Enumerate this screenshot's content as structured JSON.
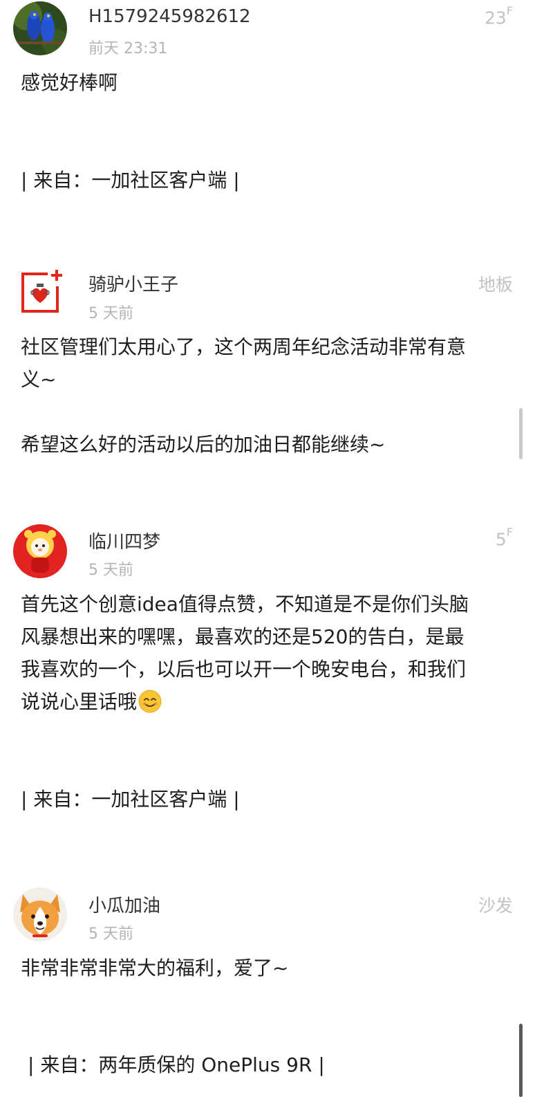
{
  "comments": [
    {
      "username": "H1579245982612",
      "time": "前天 23:31",
      "floor": "23",
      "floor_sup": "F",
      "lines": [
        "感觉好棒啊"
      ],
      "source": "| 来自：一加社区客户端 |",
      "avatar_icon": "blue-parrots-avatar"
    },
    {
      "username": "骑驴小王子",
      "time": "5 天前",
      "floor": "地板",
      "lines": [
        "社区管理们太用心了，这个两周年纪念活动非常有意",
        "义~",
        "希望这么好的活动以后的加油日都能继续~"
      ],
      "avatar_icon": "oneplus-heart-avatar"
    },
    {
      "username": "临川四梦",
      "time": "5 天前",
      "floor": "5",
      "floor_sup": "F",
      "lines": [
        "首先这个创意idea值得点赞，不知道是不是你们头脑",
        "风暴想出来的嘿嘿，最喜欢的还是520的告白，是最",
        "我喜欢的一个，以后也可以开一个晚安电台，和我们",
        "说说心里话哦"
      ],
      "source": "| 来自：一加社区客户端 |",
      "avatar_icon": "tiger-costume-avatar"
    },
    {
      "username": "小瓜加油",
      "time": "5 天前",
      "floor": "沙发",
      "lines": [
        "非常非常非常大的福利，爱了~"
      ],
      "source": "| 来自：两年质保的 OnePlus 9R |",
      "avatar_icon": "corgi-avatar"
    }
  ],
  "colors": {
    "accent_red": "#e1261c",
    "meta_gray": "#b4b4b4"
  }
}
